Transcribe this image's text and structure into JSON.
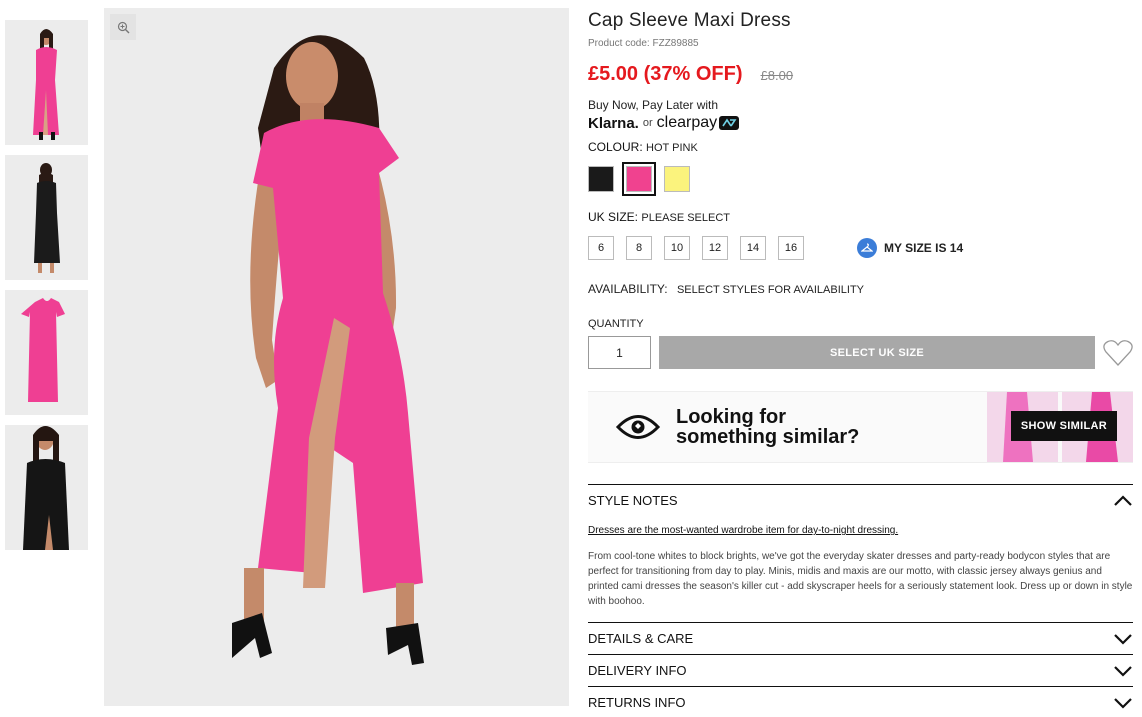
{
  "product": {
    "title": "Cap Sleeve Maxi Dress",
    "code": "Product code: FZZ89885",
    "price": "£5.00 (37% OFF)",
    "old_price": "£8.00"
  },
  "payment": {
    "line": "Buy Now, Pay Later with",
    "klarna": "Klarna.",
    "or": "or",
    "clearpay": "clearpay"
  },
  "colour": {
    "label": "COLOUR:",
    "value": "HOT PINK",
    "swatches": [
      {
        "name": "black",
        "color": "#1a1a1a"
      },
      {
        "name": "hot-pink",
        "color": "#f0428f"
      },
      {
        "name": "yellow",
        "color": "#fbf37d"
      }
    ]
  },
  "size": {
    "label": "UK SIZE:",
    "value": "PLEASE SELECT",
    "options": [
      "6",
      "8",
      "10",
      "12",
      "14",
      "16"
    ],
    "my_size": "MY SIZE IS 14"
  },
  "availability": {
    "label": "AVAILABILITY:",
    "value": "SELECT STYLES FOR AVAILABILITY"
  },
  "quantity": {
    "label": "QUANTITY",
    "value": "1",
    "button": "SELECT UK SIZE"
  },
  "similar": {
    "line1": "Looking for",
    "line2": "something similar?",
    "button": "SHOW SIMILAR"
  },
  "style_notes": {
    "title": "STYLE NOTES",
    "lead": "Dresses are the most-wanted wardrobe item for day-to-night dressing.",
    "body": "From cool-tone whites to block brights, we've got the everyday skater dresses and party-ready bodycon styles that are perfect for transitioning from day to play. Minis, midis and maxis are our motto, with classic jersey always genius and printed cami dresses the season's killer cut - add skyscraper heels for a seriously statement look. Dress up or down in style with boohoo."
  },
  "accordions": {
    "details": "DETAILS & CARE",
    "delivery": "DELIVERY INFO",
    "returns": "RETURNS INFO"
  },
  "colors": {
    "price_red": "#e5191e",
    "dress_pink": "#ef3f93",
    "button_grey": "#a8a8a8"
  }
}
